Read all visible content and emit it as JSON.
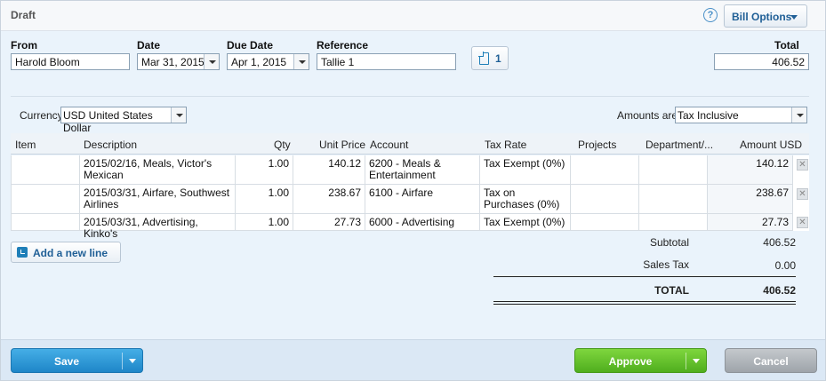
{
  "header": {
    "status": "Draft",
    "help_glyph": "?",
    "bill_options_label": "Bill Options"
  },
  "fields": {
    "from": {
      "label": "From",
      "value": "Harold Bloom"
    },
    "date": {
      "label": "Date",
      "value": "Mar 31, 2015"
    },
    "due_date": {
      "label": "Due Date",
      "value": "Apr 1, 2015"
    },
    "reference": {
      "label": "Reference",
      "value": "Tallie 1"
    },
    "attachments_count": "1",
    "total": {
      "label": "Total",
      "value": "406.52"
    }
  },
  "options": {
    "currency_label": "Currency",
    "currency_value": "USD United States Dollar",
    "amounts_label": "Amounts are",
    "amounts_value": "Tax Inclusive"
  },
  "table": {
    "columns": [
      "Item",
      "Description",
      "Qty",
      "Unit Price",
      "Account",
      "Tax Rate",
      "Projects",
      "Department/...",
      "Amount USD"
    ],
    "rows": [
      {
        "item": "",
        "description": "2015/02/16, Meals, Victor's Mexican",
        "qty": "1.00",
        "unit_price": "140.12",
        "account": "6200 - Meals & Entertainment",
        "tax_rate": "Tax Exempt (0%)",
        "projects": "",
        "department": "",
        "amount": "140.12"
      },
      {
        "item": "",
        "description": "2015/03/31, Airfare, Southwest Airlines",
        "qty": "1.00",
        "unit_price": "238.67",
        "account": "6100 - Airfare",
        "tax_rate": "Tax on Purchases (0%)",
        "projects": "",
        "department": "",
        "amount": "238.67"
      },
      {
        "item": "",
        "description": "2015/03/31, Advertising, Kinko's",
        "qty": "1.00",
        "unit_price": "27.73",
        "account": "6000 - Advertising",
        "tax_rate": "Tax Exempt (0%)",
        "projects": "",
        "department": "",
        "amount": "27.73"
      }
    ],
    "delete_glyph": "✕"
  },
  "add_line_label": "Add a new line",
  "totals": {
    "subtotal_label": "Subtotal",
    "subtotal": "406.52",
    "sales_tax_label": "Sales Tax",
    "sales_tax": "0.00",
    "total_label": "TOTAL",
    "total": "406.52"
  },
  "footer": {
    "save_label": "Save",
    "approve_label": "Approve",
    "cancel_label": "Cancel"
  },
  "colors": {
    "save": "#1e86c8",
    "approve": "#4fae1e",
    "cancel": "#9ea4aa",
    "link": "#1f5f96"
  },
  "icons": [
    "help-icon",
    "chevron-down-icon",
    "attachment-icon",
    "add-line-icon",
    "delete-icon"
  ]
}
